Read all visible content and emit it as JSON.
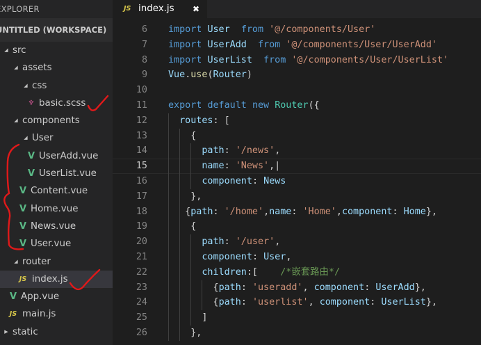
{
  "sidebar": {
    "header": "EXPLORER",
    "workspace": "UNTITLED (WORKSPACE)",
    "items": [
      {
        "label": "src",
        "depth": 0,
        "kind": "folder"
      },
      {
        "label": "assets",
        "depth": 1,
        "kind": "folder"
      },
      {
        "label": "css",
        "depth": 2,
        "kind": "folder"
      },
      {
        "label": "basic.scss",
        "depth": 3,
        "kind": "scss"
      },
      {
        "label": "components",
        "depth": 1,
        "kind": "folder"
      },
      {
        "label": "User",
        "depth": 2,
        "kind": "folder"
      },
      {
        "label": "UserAdd.vue",
        "depth": 3,
        "kind": "vue"
      },
      {
        "label": "UserList.vue",
        "depth": 3,
        "kind": "vue"
      },
      {
        "label": "Content.vue",
        "depth": 2,
        "kind": "vue"
      },
      {
        "label": "Home.vue",
        "depth": 2,
        "kind": "vue"
      },
      {
        "label": "News.vue",
        "depth": 2,
        "kind": "vue"
      },
      {
        "label": "User.vue",
        "depth": 2,
        "kind": "vue"
      },
      {
        "label": "router",
        "depth": 1,
        "kind": "folder"
      },
      {
        "label": "index.js",
        "depth": 2,
        "kind": "js",
        "active": true
      },
      {
        "label": "App.vue",
        "depth": 1,
        "kind": "vue"
      },
      {
        "label": "main.js",
        "depth": 1,
        "kind": "js"
      },
      {
        "label": "static",
        "depth": 0,
        "kind": "folder-collapsed"
      }
    ]
  },
  "tabs": [
    {
      "label": "index.js",
      "icon": "JS",
      "close": "✖"
    }
  ],
  "editor": {
    "current_line": 15,
    "lines": [
      {
        "n": "6",
        "indent": 0,
        "tokens": [
          [
            "kw",
            "import"
          ],
          [
            "punc",
            " "
          ],
          [
            "cls",
            "User"
          ],
          [
            "punc",
            "  "
          ],
          [
            "kw",
            "from"
          ],
          [
            "punc",
            " "
          ],
          [
            "str",
            "'@/components/User'"
          ]
        ]
      },
      {
        "n": "7",
        "indent": 0,
        "tokens": [
          [
            "kw",
            "import"
          ],
          [
            "punc",
            " "
          ],
          [
            "cls",
            "UserAdd"
          ],
          [
            "punc",
            "  "
          ],
          [
            "kw",
            "from"
          ],
          [
            "punc",
            " "
          ],
          [
            "str",
            "'@/components/User/UserAdd'"
          ]
        ]
      },
      {
        "n": "8",
        "indent": 0,
        "tokens": [
          [
            "kw",
            "import"
          ],
          [
            "punc",
            " "
          ],
          [
            "cls",
            "UserList"
          ],
          [
            "punc",
            "  "
          ],
          [
            "kw",
            "from"
          ],
          [
            "punc",
            " "
          ],
          [
            "str",
            "'@/components/User/UserList'"
          ]
        ]
      },
      {
        "n": "9",
        "indent": 0,
        "tokens": [
          [
            "cls",
            "Vue"
          ],
          [
            "punc",
            "."
          ],
          [
            "fn",
            "use"
          ],
          [
            "punc",
            "("
          ],
          [
            "cls",
            "Router"
          ],
          [
            "punc",
            ")"
          ]
        ]
      },
      {
        "n": "10",
        "indent": 0,
        "tokens": []
      },
      {
        "n": "11",
        "indent": 0,
        "tokens": [
          [
            "kw",
            "export"
          ],
          [
            "punc",
            " "
          ],
          [
            "kw",
            "default"
          ],
          [
            "punc",
            " "
          ],
          [
            "kw",
            "new"
          ],
          [
            "punc",
            " "
          ],
          [
            "type",
            "Router"
          ],
          [
            "punc",
            "({"
          ]
        ]
      },
      {
        "n": "12",
        "indent": 1,
        "tokens": [
          [
            "punc",
            "  "
          ],
          [
            "prop",
            "routes"
          ],
          [
            "punc",
            ": ["
          ]
        ]
      },
      {
        "n": "13",
        "indent": 2,
        "tokens": [
          [
            "punc",
            "    {"
          ]
        ]
      },
      {
        "n": "14",
        "indent": 3,
        "tokens": [
          [
            "punc",
            "      "
          ],
          [
            "prop",
            "path"
          ],
          [
            "punc",
            ": "
          ],
          [
            "str",
            "'/news'"
          ],
          [
            "punc",
            ","
          ]
        ]
      },
      {
        "n": "15",
        "indent": 3,
        "tokens": [
          [
            "punc",
            "      "
          ],
          [
            "prop",
            "name"
          ],
          [
            "punc",
            ": "
          ],
          [
            "str",
            "'News'"
          ],
          [
            "punc",
            ",|"
          ]
        ]
      },
      {
        "n": "16",
        "indent": 3,
        "tokens": [
          [
            "punc",
            "      "
          ],
          [
            "prop",
            "component"
          ],
          [
            "punc",
            ": "
          ],
          [
            "cls",
            "News"
          ]
        ]
      },
      {
        "n": "17",
        "indent": 2,
        "tokens": [
          [
            "punc",
            "    },"
          ]
        ]
      },
      {
        "n": "18",
        "indent": 2,
        "tokens": [
          [
            "punc",
            "   {"
          ],
          [
            "prop",
            "path"
          ],
          [
            "punc",
            ": "
          ],
          [
            "str",
            "'/home'"
          ],
          [
            "punc",
            ","
          ],
          [
            "prop",
            "name"
          ],
          [
            "punc",
            ": "
          ],
          [
            "str",
            "'Home'"
          ],
          [
            "punc",
            ","
          ],
          [
            "prop",
            "component"
          ],
          [
            "punc",
            ": "
          ],
          [
            "cls",
            "Home"
          ],
          [
            "punc",
            "},"
          ]
        ]
      },
      {
        "n": "19",
        "indent": 2,
        "tokens": [
          [
            "punc",
            "    {"
          ]
        ]
      },
      {
        "n": "20",
        "indent": 3,
        "tokens": [
          [
            "punc",
            "      "
          ],
          [
            "prop",
            "path"
          ],
          [
            "punc",
            ": "
          ],
          [
            "str",
            "'/user'"
          ],
          [
            "punc",
            ","
          ]
        ]
      },
      {
        "n": "21",
        "indent": 3,
        "tokens": [
          [
            "punc",
            "      "
          ],
          [
            "prop",
            "component"
          ],
          [
            "punc",
            ": "
          ],
          [
            "cls",
            "User"
          ],
          [
            "punc",
            ","
          ]
        ]
      },
      {
        "n": "22",
        "indent": 3,
        "tokens": [
          [
            "punc",
            "      "
          ],
          [
            "prop",
            "children"
          ],
          [
            "punc",
            ":[    "
          ],
          [
            "cmt",
            "/*嵌套路由*/"
          ]
        ]
      },
      {
        "n": "23",
        "indent": 4,
        "tokens": [
          [
            "punc",
            "        {"
          ],
          [
            "prop",
            "path"
          ],
          [
            "punc",
            ": "
          ],
          [
            "str",
            "'useradd'"
          ],
          [
            "punc",
            ", "
          ],
          [
            "prop",
            "component"
          ],
          [
            "punc",
            ": "
          ],
          [
            "cls",
            "UserAdd"
          ],
          [
            "punc",
            "},"
          ]
        ]
      },
      {
        "n": "24",
        "indent": 4,
        "tokens": [
          [
            "punc",
            "        {"
          ],
          [
            "prop",
            "path"
          ],
          [
            "punc",
            ": "
          ],
          [
            "str",
            "'userlist'"
          ],
          [
            "punc",
            ", "
          ],
          [
            "prop",
            "component"
          ],
          [
            "punc",
            ": "
          ],
          [
            "cls",
            "UserList"
          ],
          [
            "punc",
            "},"
          ]
        ]
      },
      {
        "n": "25",
        "indent": 3,
        "tokens": [
          [
            "punc",
            "      ]"
          ]
        ]
      },
      {
        "n": "26",
        "indent": 2,
        "tokens": [
          [
            "punc",
            "    },"
          ]
        ]
      }
    ]
  },
  "colors": {
    "sidebar_bg": "#252526",
    "editor_bg": "#1e1e1e",
    "keyword": "#569cd6",
    "string": "#ce9178",
    "identifier": "#9cdcfe",
    "comment": "#6a9955",
    "annotation_red": "#e0191a"
  },
  "icons": {
    "folder_expanded": "triangle-down-icon",
    "folder_collapsed": "triangle-right-icon",
    "vue": "vue-logo-icon",
    "js": "js-file-icon",
    "scss": "scss-file-icon"
  }
}
